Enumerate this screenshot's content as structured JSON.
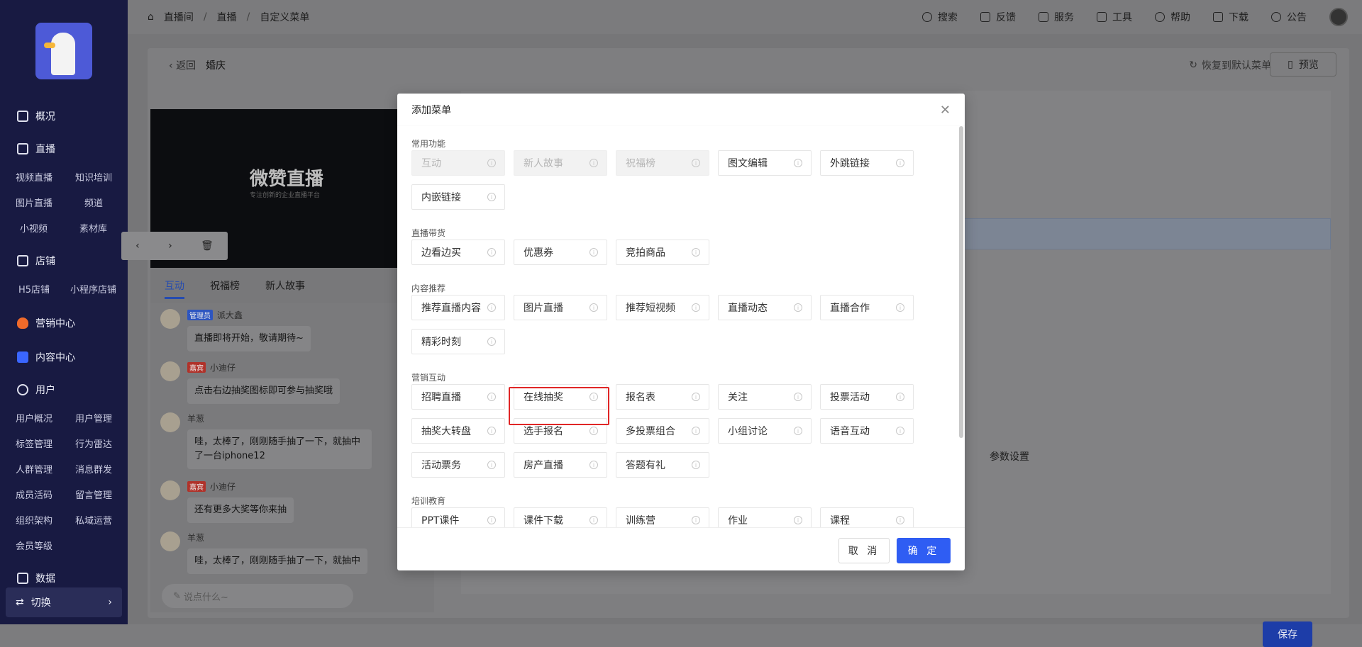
{
  "sidebar": {
    "sections": [
      {
        "label": "概况",
        "icon": "overview-icon"
      },
      {
        "label": "直播",
        "icon": "live-icon"
      },
      {
        "label": "店铺",
        "icon": "shop-icon"
      },
      {
        "label": "营销中心",
        "icon": "fire-icon"
      },
      {
        "label": "内容中心",
        "icon": "content-icon"
      },
      {
        "label": "用户",
        "icon": "user-icon"
      },
      {
        "label": "数据",
        "icon": "chart-icon"
      }
    ],
    "live_sub": [
      "视频直播",
      "知识培训",
      "图片直播",
      "频道",
      "小视频",
      "素材库"
    ],
    "shop_sub": [
      "H5店铺",
      "小程序店铺"
    ],
    "user_sub": [
      "用户概况",
      "用户管理",
      "标签管理",
      "行为雷达",
      "人群管理",
      "消息群发",
      "成员活码",
      "留言管理",
      "组织架构",
      "私域运营",
      "会员等级"
    ],
    "switch_label": "切换"
  },
  "topbar": {
    "breadcrumb": [
      "直播间",
      "直播",
      "自定义菜单"
    ],
    "tools": [
      "搜索",
      "反馈",
      "服务",
      "工具",
      "帮助",
      "下载",
      "公告"
    ]
  },
  "page": {
    "back_label": "返回",
    "title": "婚庆",
    "restore_label": "恢复到默认菜单",
    "preview_label": "预览",
    "save_label": "保存",
    "right_text": "参数设置"
  },
  "phone": {
    "brand": "微赞直播",
    "slogan": "专注创新的企业直播平台",
    "tabs": [
      "互动",
      "祝福榜",
      "新人故事"
    ],
    "messages": [
      {
        "tag": "管理员",
        "tag_type": "admin",
        "name": "派大鑫",
        "text": "直播即将开始，敬请期待~"
      },
      {
        "tag": "嘉宾",
        "tag_type": "guest",
        "name": "小迪仔",
        "text": "点击右边抽奖图标即可参与抽奖哦"
      },
      {
        "tag": "",
        "tag_type": "",
        "name": "羊葱",
        "text": "哇，太棒了，刚刚随手抽了一下，就抽中了一台iphone12"
      },
      {
        "tag": "嘉宾",
        "tag_type": "guest",
        "name": "小迪仔",
        "text": "还有更多大奖等你来抽"
      },
      {
        "tag": "",
        "tag_type": "",
        "name": "羊葱",
        "text": "哇，太棒了，刚刚随手抽了一下，就抽中"
      }
    ],
    "chat_placeholder": "说点什么~"
  },
  "modal": {
    "title": "添加菜单",
    "cancel_label": "取 消",
    "ok_label": "确 定",
    "groups": [
      {
        "title": "常用功能",
        "items": [
          {
            "label": "互动",
            "disabled": true
          },
          {
            "label": "新人故事",
            "disabled": true
          },
          {
            "label": "祝福榜",
            "disabled": true
          },
          {
            "label": "图文编辑",
            "disabled": false
          },
          {
            "label": "外跳链接",
            "disabled": false
          },
          {
            "label": "内嵌链接",
            "disabled": false
          }
        ]
      },
      {
        "title": "直播带货",
        "items": [
          {
            "label": "边看边买",
            "disabled": false
          },
          {
            "label": "优惠券",
            "disabled": false
          },
          {
            "label": "竞拍商品",
            "disabled": false
          }
        ]
      },
      {
        "title": "内容推荐",
        "items": [
          {
            "label": "推荐直播内容",
            "disabled": false
          },
          {
            "label": "图片直播",
            "disabled": false
          },
          {
            "label": "推荐短视频",
            "disabled": false
          },
          {
            "label": "直播动态",
            "disabled": false
          },
          {
            "label": "直播合作",
            "disabled": false
          },
          {
            "label": "精彩时刻",
            "disabled": false
          }
        ]
      },
      {
        "title": "营销互动",
        "items": [
          {
            "label": "招聘直播",
            "disabled": false
          },
          {
            "label": "在线抽奖",
            "disabled": false,
            "highlighted": true
          },
          {
            "label": "报名表",
            "disabled": false
          },
          {
            "label": "关注",
            "disabled": false
          },
          {
            "label": "投票活动",
            "disabled": false
          },
          {
            "label": "抽奖大转盘",
            "disabled": false
          },
          {
            "label": "选手报名",
            "disabled": false
          },
          {
            "label": "多投票组合",
            "disabled": false
          },
          {
            "label": "小组讨论",
            "disabled": false
          },
          {
            "label": "语音互动",
            "disabled": false
          },
          {
            "label": "活动票务",
            "disabled": false
          },
          {
            "label": "房产直播",
            "disabled": false
          },
          {
            "label": "答题有礼",
            "disabled": false
          }
        ]
      },
      {
        "title": "培训教育",
        "items": [
          {
            "label": "PPT课件",
            "disabled": false
          },
          {
            "label": "课件下载",
            "disabled": false
          },
          {
            "label": "训练营",
            "disabled": false
          },
          {
            "label": "作业",
            "disabled": false
          },
          {
            "label": "课程",
            "disabled": false
          }
        ]
      }
    ]
  }
}
